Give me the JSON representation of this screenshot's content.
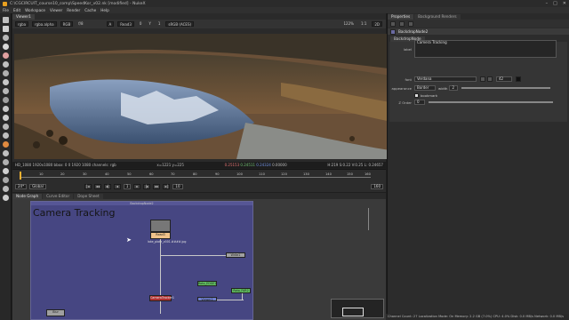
{
  "window": {
    "title": "C:\\CGCIRCUIT_course10_comp\\SpeedKor_v02.nk [modified] - NukeX",
    "controls": [
      "–",
      "□",
      "✕"
    ]
  },
  "menu": [
    "File",
    "Edit",
    "Workspace",
    "Viewer",
    "Render",
    "Cache",
    "Help"
  ],
  "viewer": {
    "tab": "Viewer1",
    "channels": "rgba",
    "alpha": "rgba.alpha",
    "colorspace": "RGB",
    "fstop": "f/8",
    "inputA": "A",
    "inputA_node": "Read3",
    "exposure": "0",
    "gain": "1",
    "gamma_label": "Y",
    "proxy": "sRGB (ACES)",
    "zoom": "122%",
    "ratio": "1:1",
    "mode": "2D",
    "info_left": "HD_1080 1920x1080  bbox: 0 0 1920 1080 channels: rgb",
    "info_xy": "x=1221 y=225",
    "info_r": "0.25153",
    "info_g": "0.24511",
    "info_b": "0.24324",
    "info_a": "0.00000",
    "info_right": "H:219 S:0.22 V:0.25  L: 0.24657"
  },
  "timeline": {
    "labels": [
      "1",
      "10",
      "20",
      "30",
      "40",
      "50",
      "60",
      "70",
      "80",
      "90",
      "100",
      "110",
      "120",
      "130",
      "140",
      "150",
      "160"
    ],
    "fps": "24*",
    "mode": "Global",
    "current_frame": "1",
    "step": "10",
    "end_frame": "160",
    "in_frame": "1",
    "out_frame": "160"
  },
  "nodegraph": {
    "tabs": [
      "Node Graph",
      "Curve Editor",
      "Dope Sheet"
    ],
    "backdrop_label": "BackdropNode2",
    "backdrop_title": "Camera Tracking",
    "read_node": "Read3",
    "read_file": "lake_plate_v001.####.jpg",
    "node_dot": "Dot1",
    "node_green1": "Roto_EDGE1",
    "node_green2": "Roto_FAR2",
    "node_blue": "Viewer2",
    "node_red": "CameraTracker1",
    "node_grey": "Write1",
    "node_grey2": "Blur"
  },
  "properties": {
    "tabs": [
      "Properties",
      "Background Renders"
    ],
    "node_name": "BackdropNode2",
    "node_tab": "BackdropNode",
    "label_label": "label",
    "label_value": "Camera Tracking",
    "font_label": "font",
    "font_value": "Verdana",
    "font_size": "42",
    "appearance_label": "appearance",
    "appearance_value": "Border",
    "width_label": "width",
    "width_value": "2",
    "bookmark_label": "bookmark",
    "zorder_label": "Z Order",
    "zorder_value": "0"
  },
  "status": "Channel Count: 27  Localization Mode: On  Memory: 2.2 GB (7.0%)  CPU: 4.0%  Disk: 0.0 MB/s  Network: 0.0 MB/s"
}
